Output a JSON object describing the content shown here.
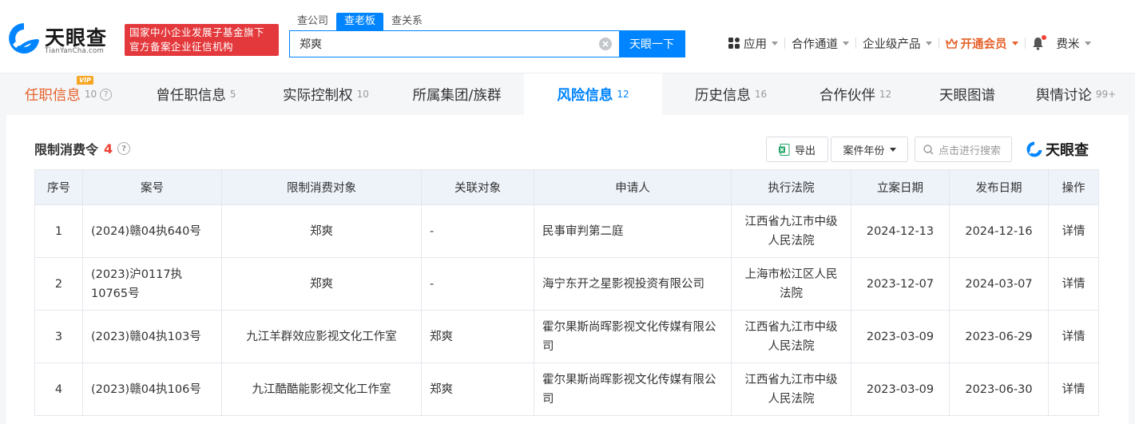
{
  "brand": {
    "name": "天眼查",
    "domain": "TianYanCha.com",
    "badge_line1": "国家中小企业发展子基金旗下",
    "badge_line2": "官方备案企业征信机构"
  },
  "search": {
    "tabs": [
      {
        "label": "查公司"
      },
      {
        "label": "查老板"
      },
      {
        "label": "查关系"
      }
    ],
    "active_tab_index": 1,
    "value": "郑爽",
    "button_label": "天眼一下"
  },
  "topnav": {
    "apps": "应用",
    "channels": "合作通道",
    "enterprise": "企业级产品",
    "vip": "开通会员",
    "user": "费米"
  },
  "tabs": [
    {
      "label": "任职信息",
      "count": "10",
      "vip": "VIP"
    },
    {
      "label": "曾任职信息",
      "count": "5"
    },
    {
      "label": "实际控制权",
      "count": "10"
    },
    {
      "label": "所属集团/族群",
      "count": ""
    },
    {
      "label": "风险信息",
      "count": "12"
    },
    {
      "label": "历史信息",
      "count": "16"
    },
    {
      "label": "合作伙伴",
      "count": "12"
    },
    {
      "label": "天眼图谱",
      "count": ""
    },
    {
      "label": "舆情讨论",
      "count": "99+"
    }
  ],
  "section": {
    "title": "限制消费令",
    "count": "4",
    "export_label": "导出",
    "year_label": "案件年份",
    "search_placeholder": "点击进行搜索",
    "brand_label": "天眼查"
  },
  "table": {
    "headers": [
      "序号",
      "案号",
      "限制消费对象",
      "关联对象",
      "申请人",
      "执行法院",
      "立案日期",
      "发布日期",
      "操作"
    ],
    "rows": [
      {
        "no": "1",
        "case_no": "(2024)赣04执640号",
        "target": "郑爽",
        "related": "-",
        "applicant": "民事审判第二庭",
        "court": "江西省九江市中级人民法院",
        "filed": "2024-12-13",
        "published": "2024-12-16",
        "action": "详情"
      },
      {
        "no": "2",
        "case_no": "(2023)沪0117执10765号",
        "target": "郑爽",
        "related": "-",
        "applicant": "海宁东开之星影视投资有限公司",
        "court": "上海市松江区人民法院",
        "filed": "2023-12-07",
        "published": "2024-03-07",
        "action": "详情"
      },
      {
        "no": "3",
        "case_no": "(2023)赣04执103号",
        "target": "九江羊群效应影视文化工作室",
        "related": "郑爽",
        "applicant": "霍尔果斯尚晖影视文化传媒有限公司",
        "court": "江西省九江市中级人民法院",
        "filed": "2023-03-09",
        "published": "2023-06-29",
        "action": "详情"
      },
      {
        "no": "4",
        "case_no": "(2023)赣04执106号",
        "target": "九江酷酷能影视文化工作室",
        "related": "郑爽",
        "applicant": "霍尔果斯尚晖影视文化传媒有限公司",
        "court": "江西省九江市中级人民法院",
        "filed": "2023-03-09",
        "published": "2023-06-30",
        "action": "详情"
      }
    ]
  },
  "colors": {
    "accent": "#0084ff",
    "badge_red": "#e4393c",
    "vip_orange": "#e5612a",
    "count_red": "#f04134"
  }
}
